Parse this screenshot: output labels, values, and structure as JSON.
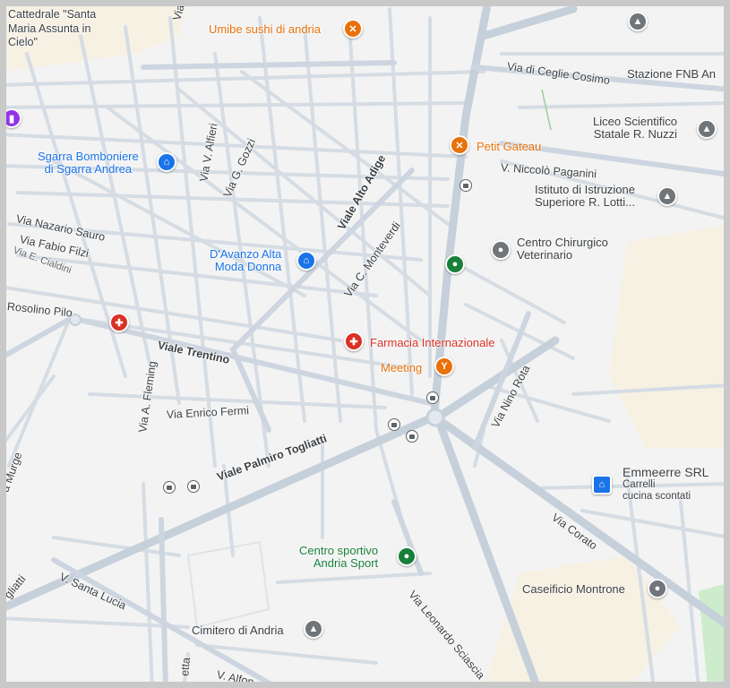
{
  "colors": {
    "land": "#f3f3f3",
    "road": "#d4dbe3",
    "main_road": "#c6d0db",
    "park": "#e8f5e1",
    "green_area": "#cdeccb",
    "sand_area": "#f7f1e3",
    "poi_blue": "#1a73e8",
    "poi_orange": "#e8710a",
    "poi_red": "#d93025",
    "poi_green": "#188038",
    "poi_gray": "#70757a"
  },
  "streets": {
    "cattedrale": "Cattedrale \"Santa Maria Assunta in Cielo\"",
    "via_v": "Via",
    "via_di_ceglie": "Via di Ceglie Cosimo",
    "via_v_alfieri": "Via V. Alfieri",
    "via_g_gozzi": "Via G. Gozzi",
    "viale_alto_adige": "Viale Alto Adige",
    "v_niccolo_paganini": "V. Niccolò Paganini",
    "via_nazario_sauro": "Via Nazario Sauro",
    "via_fabio_filzi": "Via Fabio Filzi",
    "via_e_cialdini": "Via E. Cialdini",
    "via_c_monteverdi": "Via C. Monteverdi",
    "rosolino_pilo": "Rosolino Pilo",
    "viale_trentino": "Viale Trentino",
    "via_a_fleming": "Via A. Fleming",
    "via_enrico_fermi": "Via Enrico Fermi",
    "via_nino_rota": "Via Nino Rota",
    "via_murge": "a Murge",
    "viale_palmiro_togliatti": "Viale Palmiro Togliatti",
    "via_corato": "Via Corato",
    "v_santa_lucia": "V. Santa Lucia",
    "via_leonardo_sciascia": "Via Leonardo Sciascia",
    "togliatti_edge": "gliatti",
    "via_etta": "etta",
    "v_alfon": "V. Alfon"
  },
  "pois": {
    "umibe": "Umibe sushi di andria",
    "stazione_fnb": "Stazione FNB An",
    "liceo_line1": "Liceo Scientifico",
    "liceo_line2": "Statale R. Nuzzi",
    "petit_gateau": "Petit Gateau",
    "sgarra_line1": "Sgarra Bomboniere",
    "sgarra_line2": "di Sgarra Andrea",
    "istituto_line1": "Istituto di Istruzione",
    "istituto_line2": "Superiore R. Lotti...",
    "centro_chir_line1": "Centro Chirurgico",
    "centro_chir_line2": "Veterinario",
    "davanzo_line1": "D'Avanzo Alta",
    "davanzo_line2": "Moda Donna",
    "farmacia": "Farmacia Internazionale",
    "meeting": "Meeting",
    "emmeerre": "Emmeerre SRL",
    "emmeerre_sub1": "Carrelli",
    "emmeerre_sub2": "cucina scontati",
    "centro_sportivo_line1": "Centro sportivo",
    "centro_sportivo_line2": "Andria Sport",
    "caseificio": "Caseificio Montrone",
    "cimitero": "Cimitero di Andria"
  },
  "icons": {
    "restaurant": "fork-knife-icon",
    "shopping": "shopping-bag-icon",
    "school": "graduation-cap-icon",
    "pharmacy": "pharmacy-cross-icon",
    "bar": "cocktail-icon",
    "sports": "sports-pin-icon",
    "vet": "vet-pin-icon",
    "cemetery": "cemetery-icon",
    "bus": "bus-stop-icon",
    "worship": "place-of-worship-icon"
  }
}
